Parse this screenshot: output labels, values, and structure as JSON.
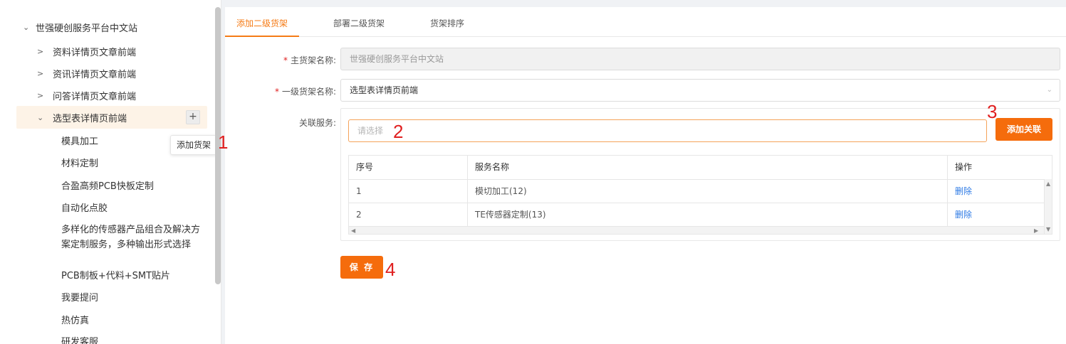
{
  "tree": {
    "root": {
      "label": "世强硬创服务平台中文站",
      "expanded": true
    },
    "level1": [
      {
        "label": "资料详情页文章前端",
        "expanded": false
      },
      {
        "label": "资讯详情页文章前端",
        "expanded": false
      },
      {
        "label": "问答详情页文章前端",
        "expanded": false
      },
      {
        "label": "选型表详情页前端",
        "expanded": true,
        "active": true
      }
    ],
    "level2": [
      "模具加工",
      "材料定制",
      "合盈高频PCB快板定制",
      "自动化点胶",
      "多样化的传感器产品组合及解决方案定制服务，多种输出形式选择",
      "PCB制板+代料+SMT贴片",
      "我要提问",
      "热仿真",
      "研发客服"
    ],
    "plus_icon": "+",
    "tooltip": "添加货架"
  },
  "annotations": [
    "1",
    "2",
    "3",
    "4"
  ],
  "tabs": [
    {
      "label": "添加二级货架",
      "active": true
    },
    {
      "label": "部署二级货架",
      "active": false
    },
    {
      "label": "货架排序",
      "active": false
    }
  ],
  "form": {
    "main_shelf": {
      "required_mark": "*",
      "label": "主货架名称:",
      "value": "世强硬创服务平台中文站"
    },
    "level1_shelf": {
      "required_mark": "*",
      "label": "一级货架名称:",
      "value": "选型表详情页前端"
    },
    "services": {
      "label": "关联服务:",
      "placeholder": "请选择",
      "add_button": "添加关联",
      "columns": [
        "序号",
        "服务名称",
        "操作"
      ],
      "rows": [
        {
          "no": "1",
          "name": "模切加工(12)",
          "action": "删除"
        },
        {
          "no": "2",
          "name": "TE传感器定制(13)",
          "action": "删除"
        }
      ]
    },
    "save_button": "保 存"
  },
  "colors": {
    "accent": "#f56c0c",
    "link": "#2f7be5",
    "required": "#e02020"
  },
  "icons": {
    "collapse": "chevron-down-icon",
    "expand": "chevron-right-icon",
    "select": "chevron-down-icon"
  }
}
